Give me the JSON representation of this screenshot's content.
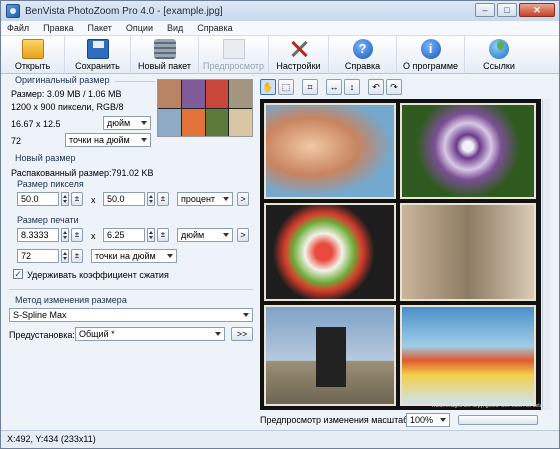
{
  "window": {
    "title": "BenVista PhotoZoom Pro 4.0 - [example.jpg]",
    "min_label": "–",
    "max_label": "□",
    "close_label": "✕"
  },
  "menu": [
    "Файл",
    "Правка",
    "Пакет",
    "Опции",
    "Вид",
    "Справка"
  ],
  "toolbar": {
    "open": "Открыть",
    "save": "Сохранить",
    "batch": "Новый пакет",
    "preview": "Предпросмотр",
    "settings": "Настройки",
    "help": "Справка",
    "about": "О программе",
    "links": "Ссылки",
    "help_glyph": "?",
    "about_glyph": "i"
  },
  "original": {
    "title": "Оригинальный размер",
    "size": "Размер: 3.09 MB / 1.06 MB",
    "pixels": "1200 x 900 пиксели, RGB/8",
    "dims": "16.67 x 12.5",
    "unit": "дюйм",
    "res": "72",
    "res_unit": "точки на дюйм"
  },
  "newsize": {
    "title": "Новый размер",
    "unpacked": "Распакованный размер:791.02 KB",
    "pixel_group": "Размер пикселя",
    "pw": "50.0",
    "ph": "50.0",
    "pixel_unit": "процент",
    "x": "x",
    "print_group": "Размер печати",
    "prw": "8.3333",
    "prh": "6.25",
    "print_unit": "дюйм",
    "pres": "72",
    "pres_unit": "точки на дюйм",
    "keep_ratio": "Удерживать коэффициент сжатия",
    "keep_checked": "✓",
    "go": ">",
    "spin_btn": "±"
  },
  "method": {
    "title": "Метод изменения размера",
    "value": "S-Spline Max",
    "preset_label": "Предустановка:",
    "preset_value": "Общий *",
    "more": ">>"
  },
  "view": {
    "zoom_label": "Предпросмотр изменения масштаба:",
    "zoom_value": "100%",
    "copyright": "These images are copyrighted. See EULA for details"
  },
  "status": "X:492, Y:434  (233x11)"
}
